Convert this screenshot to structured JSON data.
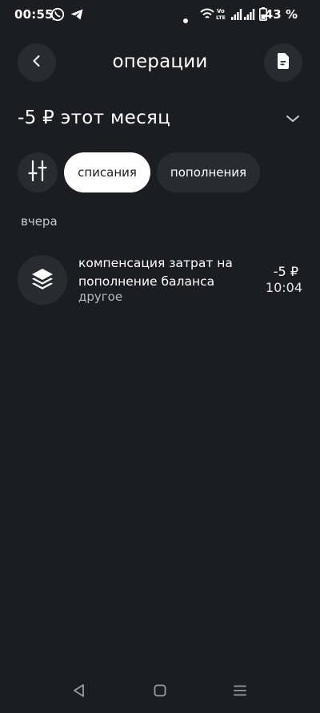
{
  "status_bar": {
    "time": "00:55",
    "battery_percent": "43 %",
    "icons": [
      "whatsapp-icon",
      "telegram-icon",
      "notification-dot-icon",
      "wifi-icon",
      "volte-icon",
      "signal-icon",
      "signal-icon",
      "battery-icon"
    ]
  },
  "header": {
    "title": "операции",
    "back_icon": "chevron-left-icon",
    "document_icon": "document-icon"
  },
  "summary": {
    "period_title": "-5 ₽ этот месяц",
    "expand_icon": "chevron-down-icon"
  },
  "filters": {
    "settings_icon": "sliders-icon",
    "chips": [
      {
        "label": "списания",
        "active": true
      },
      {
        "label": "пополнения",
        "active": false
      }
    ]
  },
  "groups": [
    {
      "date_label": "вчера",
      "transactions": [
        {
          "icon": "layers-icon",
          "title": "компенсация затрат на пополнение баланса",
          "category": "другое",
          "amount": "-5 ₽",
          "time": "10:04"
        }
      ]
    }
  ],
  "nav_bar": {
    "icons": [
      "back-triangle-icon",
      "home-square-icon",
      "menu-lines-icon"
    ]
  },
  "colors": {
    "background": "#1c1d23",
    "surface": "#292b32",
    "text_primary": "#ffffff",
    "text_secondary": "#b8b9bf"
  }
}
